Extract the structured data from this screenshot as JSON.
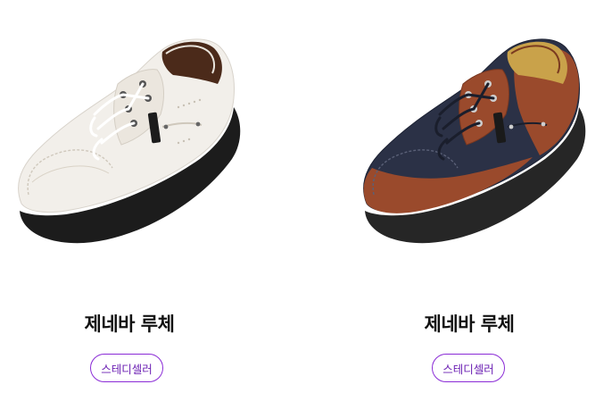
{
  "products": [
    {
      "name": "제네바 루체",
      "brand_badge": "스테디셀러",
      "image_icon": "white-leather-shoe-image",
      "colors": {
        "upper": "#f2efea",
        "sole": "#1c1c1c",
        "lining": "#6a3a22",
        "badge_border": "#8a2bd6"
      }
    },
    {
      "name": "제네바 루체",
      "brand_badge": "스테디셀러",
      "image_icon": "navy-brown-shoe-image",
      "colors": {
        "upper": "#2b3146",
        "accent": "#9a4a2c",
        "sole": "#2a2a2a",
        "badge_border": "#8a2bd6"
      }
    }
  ]
}
